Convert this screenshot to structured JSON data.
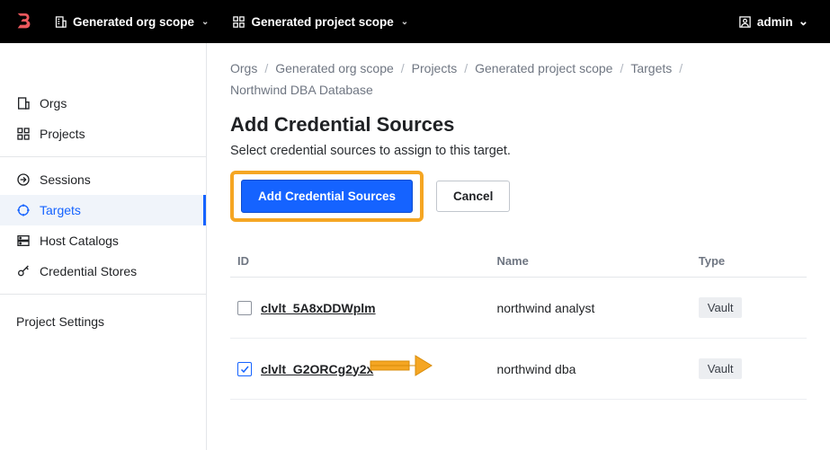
{
  "topbar": {
    "org_scope": "Generated org scope",
    "project_scope": "Generated project scope",
    "user": "admin"
  },
  "sidebar": {
    "items": [
      {
        "label": "Orgs"
      },
      {
        "label": "Projects"
      },
      {
        "label": "Sessions"
      },
      {
        "label": "Targets"
      },
      {
        "label": "Host Catalogs"
      },
      {
        "label": "Credential Stores"
      }
    ],
    "settings_label": "Project Settings"
  },
  "breadcrumb": [
    "Orgs",
    "Generated org scope",
    "Projects",
    "Generated project scope",
    "Targets",
    "Northwind DBA Database"
  ],
  "page": {
    "title": "Add Credential Sources",
    "subtitle": "Select credential sources to assign to this target.",
    "primary_btn": "Add Credential Sources",
    "cancel_btn": "Cancel"
  },
  "table": {
    "headers": {
      "id": "ID",
      "name": "Name",
      "type": "Type"
    },
    "rows": [
      {
        "checked": false,
        "id": "clvlt_5A8xDDWplm",
        "name": "northwind analyst",
        "type": "Vault"
      },
      {
        "checked": true,
        "id": "clvlt_G2ORCg2y2x",
        "name": "northwind dba",
        "type": "Vault"
      }
    ]
  }
}
